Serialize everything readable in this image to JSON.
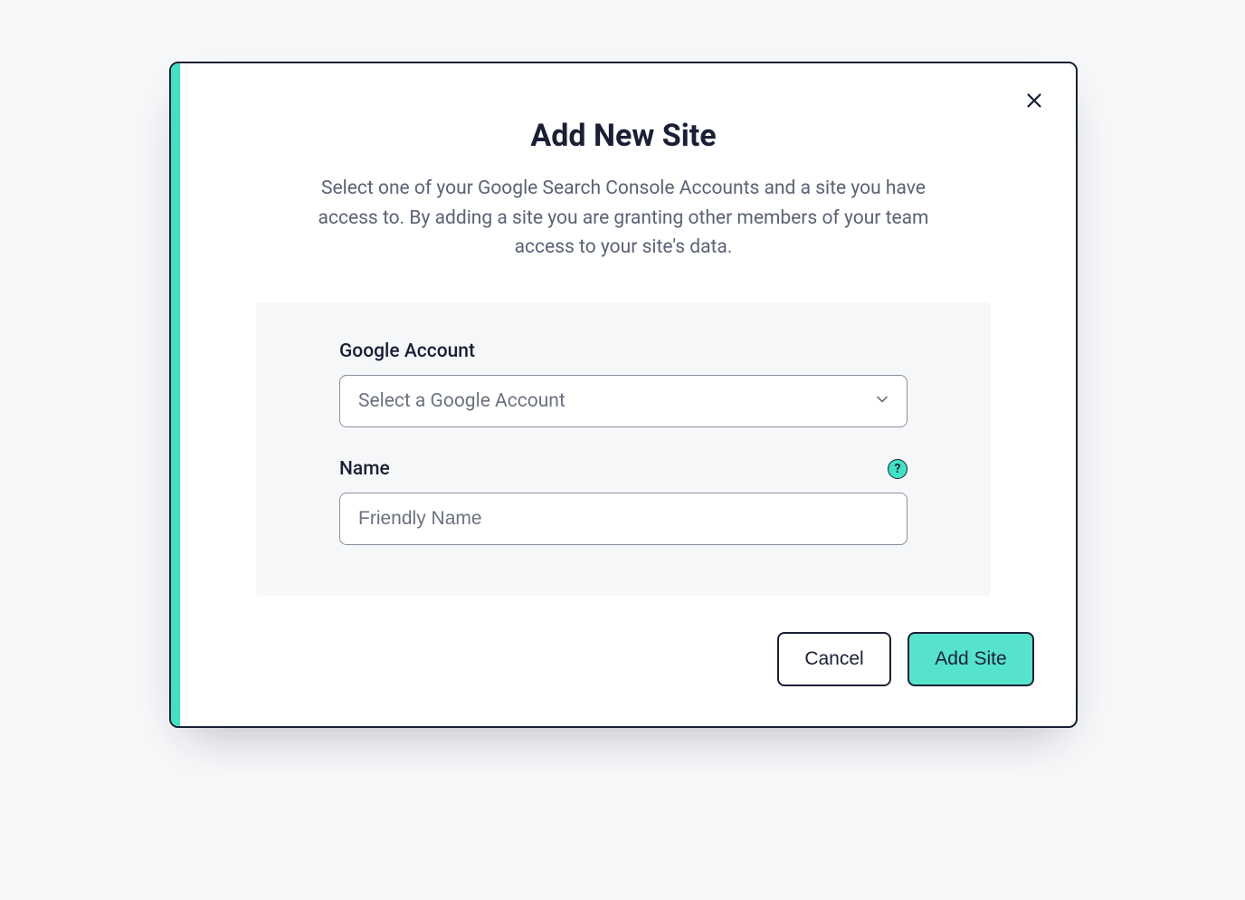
{
  "modal": {
    "title": "Add New Site",
    "subtitle": "Select one of your Google Search Console Accounts and a site you have access to. By adding a site you are granting other members of your team access to your site's data.",
    "accent_color": "#3FE2C3"
  },
  "form": {
    "google_account": {
      "label": "Google Account",
      "placeholder": "Select a Google Account",
      "selected": "Select a Google Account"
    },
    "name": {
      "label": "Name",
      "placeholder": "Friendly Name",
      "value": "",
      "help_tooltip": "?"
    }
  },
  "footer": {
    "cancel_label": "Cancel",
    "submit_label": "Add Site"
  }
}
